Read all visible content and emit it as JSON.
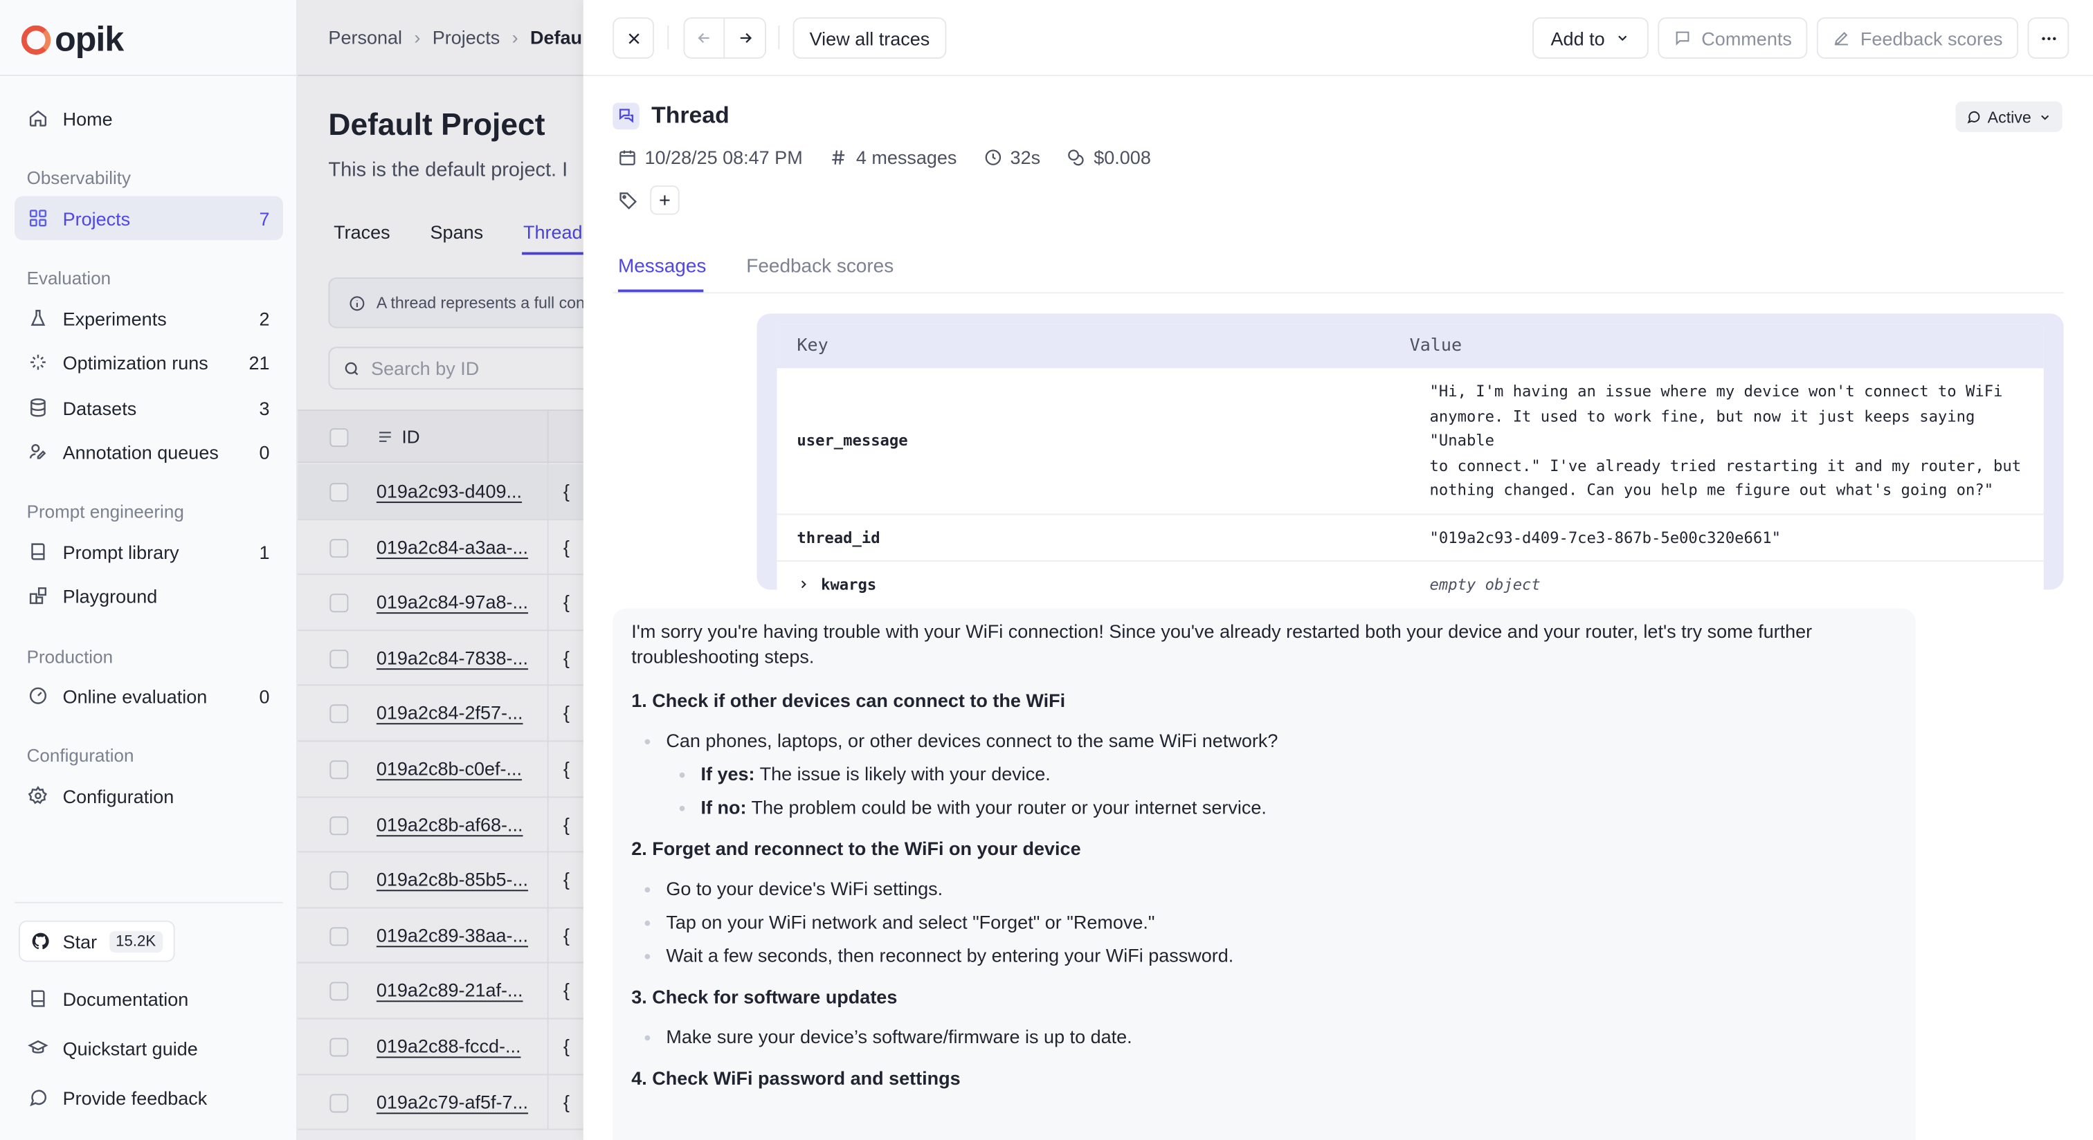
{
  "app": {
    "name": "opik"
  },
  "sidebar": {
    "sections": {
      "observability": "Observability",
      "evaluation": "Evaluation",
      "prompt_engineering": "Prompt engineering",
      "production": "Production",
      "configuration": "Configuration"
    },
    "items": [
      {
        "label": "Home",
        "count": "",
        "icon": "home-icon"
      },
      {
        "label": "Projects",
        "count": "7",
        "icon": "grid-icon"
      },
      {
        "label": "Experiments",
        "count": "2",
        "icon": "flask-icon"
      },
      {
        "label": "Optimization runs",
        "count": "21",
        "icon": "sparkle-icon"
      },
      {
        "label": "Datasets",
        "count": "3",
        "icon": "database-icon"
      },
      {
        "label": "Annotation queues",
        "count": "0",
        "icon": "annotate-icon"
      },
      {
        "label": "Prompt library",
        "count": "1",
        "icon": "book-icon"
      },
      {
        "label": "Playground",
        "count": "",
        "icon": "blocks-icon"
      },
      {
        "label": "Online evaluation",
        "count": "0",
        "icon": "gauge-icon"
      },
      {
        "label": "Configuration",
        "count": "",
        "icon": "gear-icon"
      }
    ],
    "star": {
      "label": "Star",
      "count": "15.2K"
    },
    "footer": [
      {
        "label": "Documentation",
        "icon": "book-icon"
      },
      {
        "label": "Quickstart guide",
        "icon": "graduation-icon"
      },
      {
        "label": "Provide feedback",
        "icon": "message-icon"
      }
    ]
  },
  "main": {
    "breadcrumb": [
      "Personal",
      "Projects",
      "Defau"
    ],
    "title": "Default Project",
    "description": "This is the default project. I",
    "tabs": [
      "Traces",
      "Spans",
      "Thread"
    ],
    "info": "A thread represents a full conv",
    "search_placeholder": "Search by ID",
    "column_id": "ID",
    "rows": [
      "019a2c93-d409...",
      "019a2c84-a3aa-...",
      "019a2c84-97a8-...",
      "019a2c84-7838-...",
      "019a2c84-2f57-...",
      "019a2c8b-c0ef-...",
      "019a2c8b-af68-...",
      "019a2c8b-85b5-...",
      "019a2c89-38aa-...",
      "019a2c89-21af-...",
      "019a2c88-fccd-...",
      "019a2c79-af5f-7..."
    ],
    "row_brace": "{"
  },
  "panel": {
    "view_all": "View all traces",
    "add_to": "Add to",
    "comments": "Comments",
    "feedback_scores_btn": "Feedback scores",
    "title": "Thread",
    "status": "Active",
    "meta": {
      "date": "10/28/25 08:47 PM",
      "messages": "4 messages",
      "duration": "32s",
      "cost": "$0.008"
    },
    "tabs": [
      "Messages",
      "Feedback scores"
    ],
    "kv": {
      "key_header": "Key",
      "value_header": "Value",
      "rows": [
        {
          "key": "user_message",
          "value": "\"Hi, I'm having an issue where my device won't connect to WiFi\nanymore. It used to work fine, but now it just keeps saying \"Unable\nto connect.\" I've already tried restarting it and my router, but\nnothing changed. Can you help me figure out what's going on?\""
        },
        {
          "key": "thread_id",
          "value": "\"019a2c93-d409-7ce3-867b-5e00c320e661\""
        },
        {
          "key": "kwargs",
          "value": "empty object"
        }
      ]
    },
    "answer": {
      "intro": "I'm sorry you're having trouble with your WiFi connection! Since you've already restarted both your device and your router, let's try some further troubleshooting steps.",
      "h1": "1. Check if other devices can connect to the WiFi",
      "s1_b1": "Can phones, laptops, or other devices connect to the same WiFi network?",
      "s1_yes_label": "If yes:",
      "s1_yes": " The issue is likely with your device.",
      "s1_no_label": "If no:",
      "s1_no": " The problem could be with your router or your internet service.",
      "h2": "2. Forget and reconnect to the WiFi on your device",
      "s2_b1": "Go to your device's WiFi settings.",
      "s2_b2": "Tap on your WiFi network and select \"Forget\" or \"Remove.\"",
      "s2_b3": "Wait a few seconds, then reconnect by entering your WiFi password.",
      "h3": "3. Check for software updates",
      "s3_b1": "Make sure your device’s software/firmware is up to date.",
      "h4": "4. Check WiFi password and settings"
    }
  }
}
